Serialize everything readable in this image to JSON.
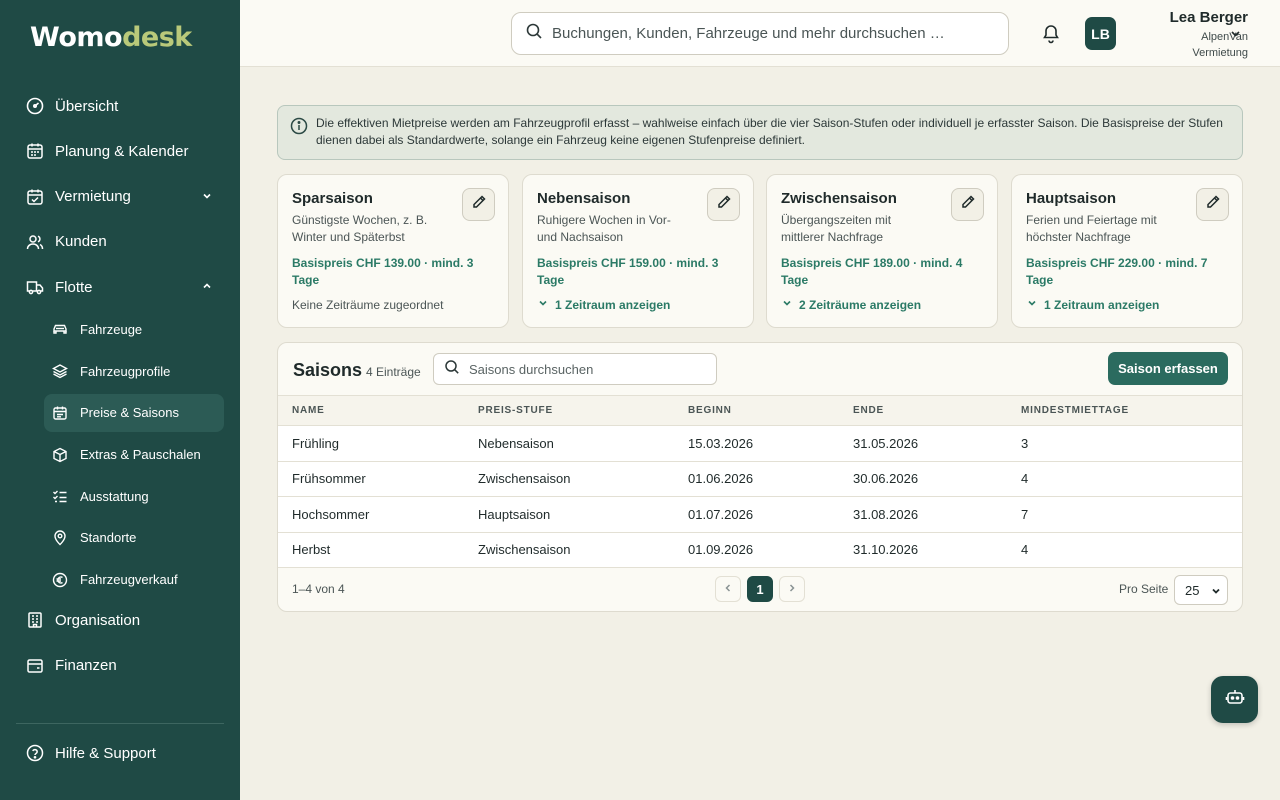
{
  "brand": {
    "part1": "W",
    "part2": "omo",
    "part3": "desk",
    "accent": "#b9c97a",
    "sidebar_bg": "#1f4a45"
  },
  "sidebar": {
    "items": [
      {
        "label": "Übersicht",
        "icon": "dashboard-gauge-icon"
      },
      {
        "label": "Planung & Kalender",
        "icon": "calendar-icon"
      },
      {
        "label": "Vermietung",
        "icon": "calendar-check-icon",
        "chevron": "chevron-down-icon"
      },
      {
        "label": "Kunden",
        "icon": "users-icon"
      },
      {
        "label": "Flotte",
        "icon": "truck-icon",
        "chevron": "chevron-up-icon"
      }
    ],
    "flotte_sub": [
      {
        "label": "Fahrzeuge",
        "icon": "car-icon"
      },
      {
        "label": "Fahrzeugprofile",
        "icon": "layers-icon"
      },
      {
        "label": "Preise & Saisons",
        "icon": "calendar-price-icon",
        "active": true
      },
      {
        "label": "Extras & Pauschalen",
        "icon": "package-icon"
      },
      {
        "label": "Ausstattung",
        "icon": "checklist-icon"
      },
      {
        "label": "Standorte",
        "icon": "map-pin-icon"
      },
      {
        "label": "Fahrzeugverkauf",
        "icon": "euro-circle-icon"
      }
    ],
    "bottom_items": [
      {
        "label": "Organisation",
        "icon": "building-icon"
      },
      {
        "label": "Finanzen",
        "icon": "wallet-icon"
      }
    ],
    "help": "Hilfe & Support"
  },
  "header": {
    "search_placeholder": "Buchungen, Kunden, Fahrzeuge und mehr durchsuchen …",
    "avatar_initials": "LB",
    "user_name": "Lea Berger",
    "user_org_line1": "AlpenVan",
    "user_org_line2": "Vermietung"
  },
  "info_text": "Die effektiven Mietpreise werden am Fahrzeugprofil erfasst – wahlweise einfach über die vier Saison-Stufen oder individuell je erfasster Saison. Die Basispreise der Stufen dienen dabei als Standardwerte, solange ein Fahrzeug keine eigenen Stufenpreise definiert.",
  "cards": [
    {
      "title": "Sparsaison",
      "desc": "Günstigste Wochen, z. B. Winter und Späterbst",
      "price": "Basispreis CHF 139.00 · mind. 3 Tage",
      "footer": "Keine Zeiträume zugeordnet",
      "footer_type": "empty"
    },
    {
      "title": "Nebensaison",
      "desc": "Ruhigere Wochen in Vor- und Nachsaison",
      "price": "Basispreis CHF 159.00 · mind. 3 Tage",
      "footer": "1 Zeitraum anzeigen",
      "footer_type": "toggle"
    },
    {
      "title": "Zwischensaison",
      "desc": "Übergangszeiten mit mittlerer Nachfrage",
      "price": "Basispreis CHF 189.00 · mind. 4 Tage",
      "footer": "2 Zeiträume anzeigen",
      "footer_type": "toggle"
    },
    {
      "title": "Hauptsaison",
      "desc": "Ferien und Feiertage mit höchster Nachfrage",
      "price": "Basispreis CHF 229.00 · mind. 7 Tage",
      "footer": "1 Zeitraum anzeigen",
      "footer_type": "toggle"
    }
  ],
  "table_panel": {
    "title": "Saisons",
    "count": "4 Einträge",
    "search_placeholder": "Saisons durchsuchen",
    "add_label": "Saison erfassen",
    "columns": [
      "NAME",
      "PREIS-STUFE",
      "BEGINN",
      "ENDE",
      "MINDESTMIETTAGE"
    ],
    "rows": [
      [
        "Frühling",
        "Nebensaison",
        "15.03.2026",
        "31.05.2026",
        "3"
      ],
      [
        "Frühsommer",
        "Zwischensaison",
        "01.06.2026",
        "30.06.2026",
        "4"
      ],
      [
        "Hochsommer",
        "Hauptsaison",
        "01.07.2026",
        "31.08.2026",
        "7"
      ],
      [
        "Herbst",
        "Zwischensaison",
        "01.09.2026",
        "31.10.2026",
        "4"
      ]
    ],
    "range": "1–4 von 4",
    "current_page": "1",
    "per_page_label": "Pro Seite",
    "per_page_value": "25"
  }
}
